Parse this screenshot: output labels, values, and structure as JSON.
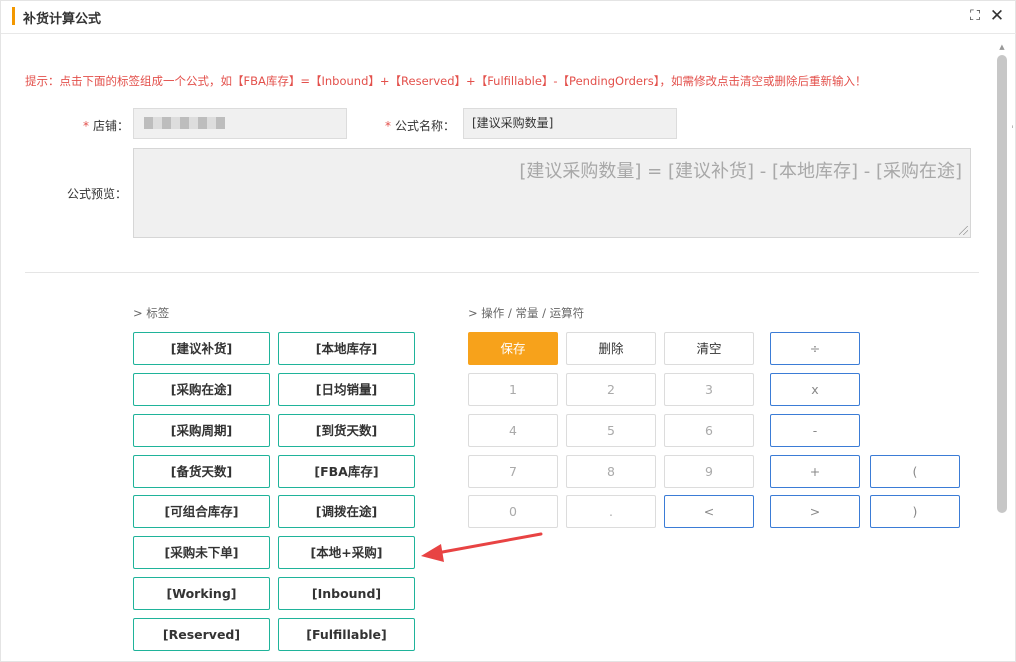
{
  "dialog": {
    "title": "补货计算公式",
    "maximize_icon": "⛶",
    "close_icon": "✕"
  },
  "tip": "提示：点击下面的标签组成一个公式，如【FBA库存】=【Inbound】+【Reserved】+【Fulfillable】-【PendingOrders】，如需修改点击清空或删除后重新输入！",
  "form": {
    "store_label": "店铺：",
    "formula_name_label": "公式名称：",
    "formula_name_value": "[建议采购数量]",
    "preview_label": "公式预览：",
    "preview_value": "[建议采购数量] = [建议补货] - [本地库存] - [采购在途]"
  },
  "sections": {
    "tags_title": "> 标签",
    "ops_title": "> 操作 / 常量 / 运算符"
  },
  "tags": [
    "[建议补货]",
    "[本地库存]",
    "[采购在途]",
    "[日均销量]",
    "[采购周期]",
    "[到货天数]",
    "[备货天数]",
    "[FBA库存]",
    "[可组合库存]",
    "[调拨在途]",
    "[采购未下单]",
    "[本地+采购]",
    "[Working]",
    "[Inbound]",
    "[Reserved]",
    "[Fulfillable]"
  ],
  "actions": {
    "save": "保存",
    "delete": "删除",
    "clear": "清空"
  },
  "numbers": [
    "1",
    "2",
    "3",
    "4",
    "5",
    "6",
    "7",
    "8",
    "9",
    "0",
    "."
  ],
  "operators": {
    "divide": "÷",
    "multiply": "x",
    "minus": "-",
    "plus": "+",
    "lparen": "(",
    "less": "<",
    "greater": ">",
    "rparen": ")"
  },
  "colors": {
    "accent": "#f7a21b",
    "tag_border": "#1fb39a",
    "operator_border": "#3b7cd6",
    "tip_text": "#e3504b",
    "annotation_arrow": "#e84343"
  }
}
